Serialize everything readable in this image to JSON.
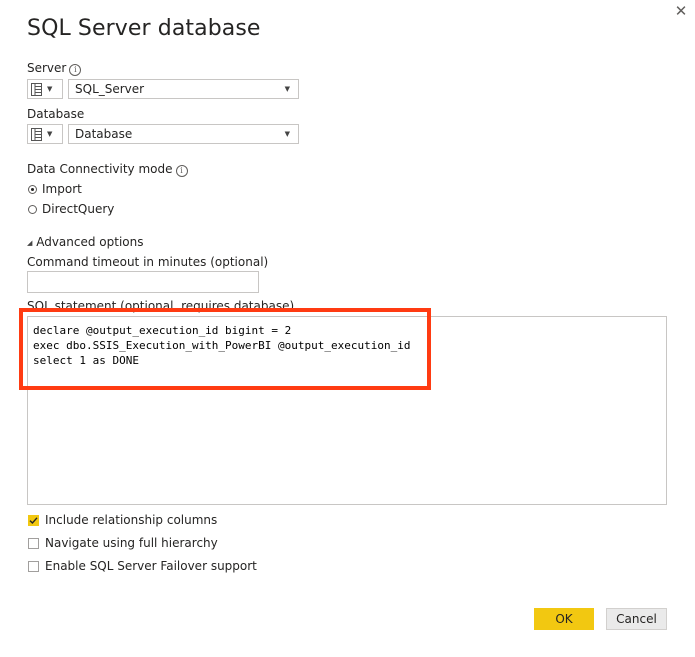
{
  "dialog": {
    "title": "SQL Server database",
    "close_icon": "close-icon"
  },
  "server": {
    "label": "Server",
    "value": "SQL_Server"
  },
  "database": {
    "label": "Database",
    "value": "Database"
  },
  "connectivity": {
    "label": "Data Connectivity mode",
    "options": [
      {
        "label": "Import",
        "selected": true
      },
      {
        "label": "DirectQuery",
        "selected": false
      }
    ]
  },
  "advanced": {
    "toggle_label": "Advanced options",
    "timeout_label": "Command timeout in minutes (optional)",
    "timeout_value": "",
    "sql_label": "SQL statement (optional, requires database)",
    "sql_lines": [
      "declare @output_execution_id bigint = 2",
      "exec dbo.SSIS_Execution_with_PowerBI @output_execution_id",
      "select 1 as DONE"
    ],
    "highlight_color": "#ff3b12"
  },
  "options": {
    "checkboxes": [
      {
        "label": "Include relationship columns",
        "checked": true
      },
      {
        "label": "Navigate using full hierarchy",
        "checked": false
      },
      {
        "label": "Enable SQL Server Failover support",
        "checked": false
      }
    ]
  },
  "buttons": {
    "ok_label": "OK",
    "cancel_label": "Cancel"
  },
  "colors": {
    "accent": "#f2c811",
    "highlight": "#ff3b12"
  }
}
